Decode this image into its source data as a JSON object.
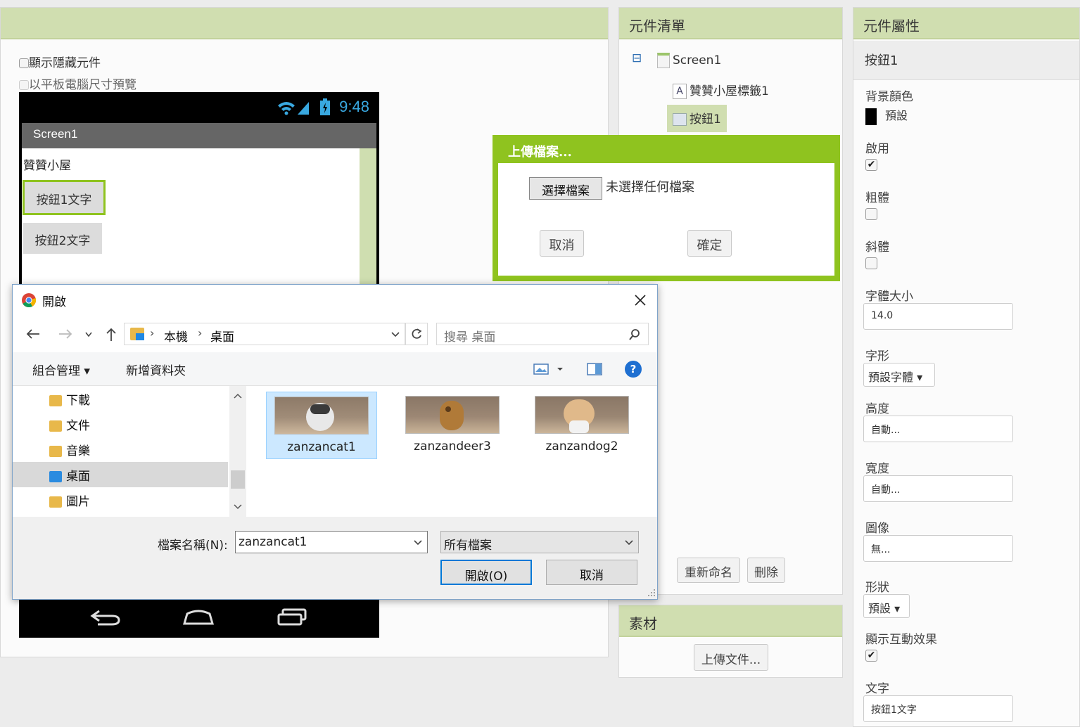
{
  "viewer": {
    "options": [
      "顯示隱藏元件",
      "以平板電腦尺寸預覽"
    ],
    "phone": {
      "clock": "9:48",
      "screen_title": "Screen1",
      "label_text": "贊贊小屋",
      "button1": "按鈕1文字",
      "button2": "按鈕2文字"
    }
  },
  "components": {
    "header": "元件清單",
    "tree": [
      "Screen1",
      "贊贊小屋標籤1",
      "按鈕1"
    ],
    "rename": "重新命名",
    "delete": "刪除",
    "collapse_symbol": "⊟"
  },
  "media": {
    "header": "素材",
    "upload": "上傳文件..."
  },
  "properties": {
    "header": "元件屬性",
    "component": "按鈕1",
    "bg_label": "背景顏色",
    "bg_value": "預設",
    "bg_color": "#000000",
    "enabled_label": "啟用",
    "bold_label": "粗體",
    "italic_label": "斜體",
    "fontsize_label": "字體大小",
    "fontsize_value": "14.0",
    "typeface_label": "字形",
    "typeface_value": "預設字體 ▾",
    "height_label": "高度",
    "height_value": "自動...",
    "width_label": "寬度",
    "width_value": "自動...",
    "image_label": "圖像",
    "image_value": "無...",
    "shape_label": "形狀",
    "shape_value": "預設 ▾",
    "feedback_label": "顯示互動效果",
    "text_label": "文字",
    "text_value": "按鈕1文字",
    "check_mark": "✔"
  },
  "upload_dialog": {
    "title": "上傳檔案...",
    "choose": "選擇檔案",
    "no_file": "未選擇任何檔案",
    "cancel": "取消",
    "ok": "確定",
    "accent": "#8fc31f"
  },
  "open_dialog": {
    "title": "開啟",
    "breadcrumb": [
      "本機",
      "桌面"
    ],
    "search_placeholder": "搜尋 桌面",
    "organize": "組合管理 ▾",
    "new_folder": "新增資料夾",
    "help": "?",
    "nav_items": [
      "下載",
      "文件",
      "音樂",
      "桌面",
      "圖片"
    ],
    "files": [
      "zanzancat1",
      "zanzandeer3",
      "zanzandog2"
    ],
    "filename_label": "檔案名稱(N):",
    "filename_value": "zanzancat1",
    "filter": "所有檔案",
    "open": "開啟(O)",
    "cancel": "取消"
  }
}
